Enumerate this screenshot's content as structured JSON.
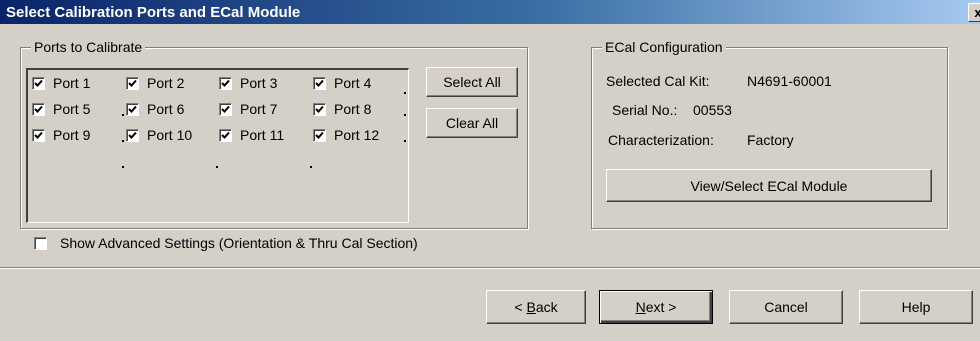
{
  "dialog": {
    "title": "Select Calibration Ports and ECal Module",
    "close_glyph": "x"
  },
  "ports_group": {
    "legend": "Ports to Calibrate",
    "ports": [
      {
        "label": "Port 1",
        "checked": true
      },
      {
        "label": "Port 2",
        "checked": true
      },
      {
        "label": "Port 3",
        "checked": true
      },
      {
        "label": "Port 4",
        "checked": true
      },
      {
        "label": "Port 5",
        "checked": true
      },
      {
        "label": "Port 6",
        "checked": true
      },
      {
        "label": "Port 7",
        "checked": true
      },
      {
        "label": "Port 8",
        "checked": true
      },
      {
        "label": "Port 9",
        "checked": true
      },
      {
        "label": "Port 10",
        "checked": true
      },
      {
        "label": "Port 11",
        "checked": true
      },
      {
        "label": "Port 12",
        "checked": true
      }
    ],
    "select_all_label": "Select All",
    "clear_all_label": "Clear All"
  },
  "ecal_group": {
    "legend": "ECal Configuration",
    "selected_cal_kit_label": "Selected Cal Kit:",
    "selected_cal_kit_value": "N4691-60001",
    "serial_label": "Serial No.:",
    "serial_value": "00553",
    "characterization_label": "Characterization:",
    "characterization_value": "Factory",
    "view_select_label": "View/Select ECal Module"
  },
  "advanced": {
    "label": "Show Advanced Settings (Orientation & Thru Cal Section)",
    "checked": false
  },
  "footer": {
    "back_prefix": "< ",
    "back_mnemonic": "B",
    "back_rest": "ack",
    "next_mnemonic": "N",
    "next_rest": "ext >",
    "cancel_label": "Cancel",
    "help_label": "Help"
  }
}
